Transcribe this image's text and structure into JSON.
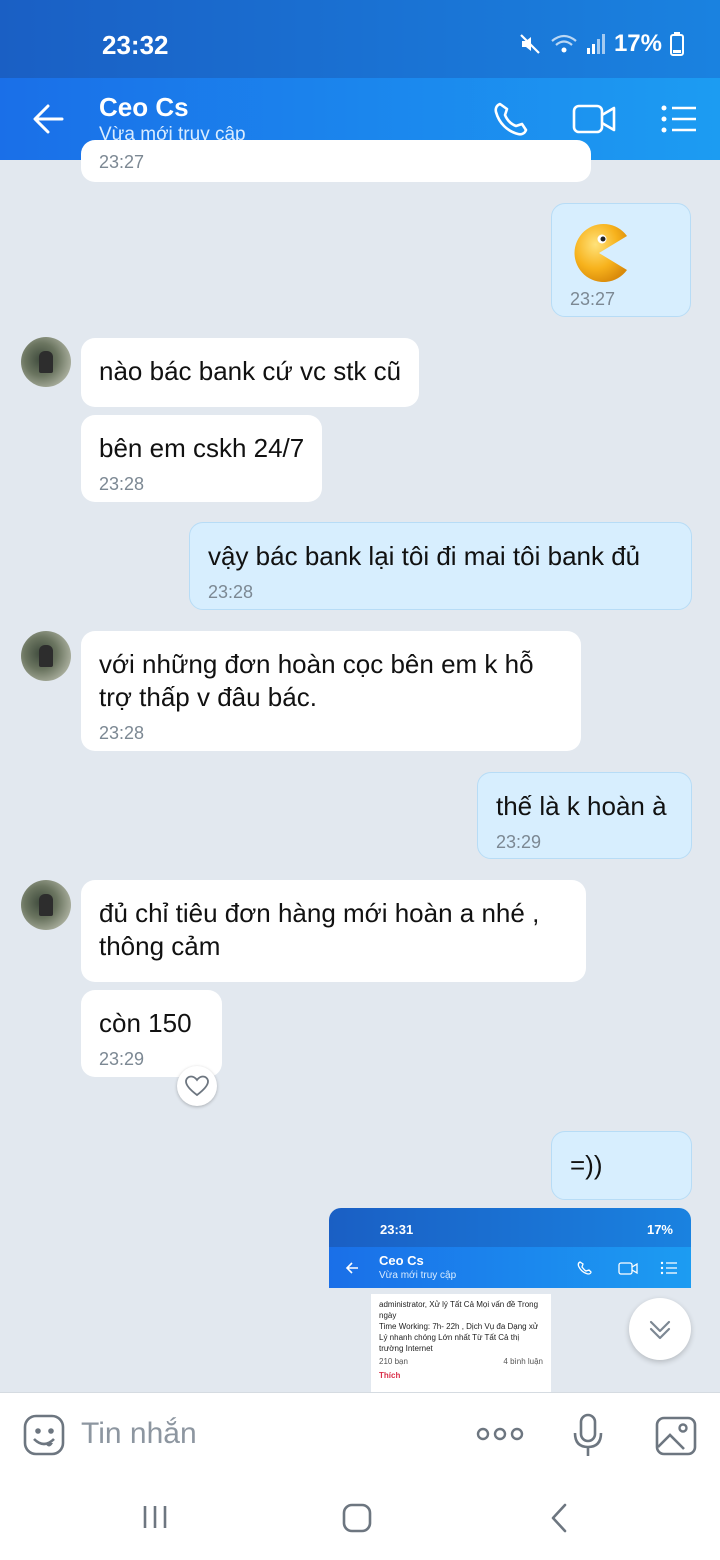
{
  "status_bar": {
    "time": "23:32",
    "battery": "17%"
  },
  "header": {
    "title": "Ceo Cs",
    "subtitle": "Vừa mới truy cập"
  },
  "messages": [
    {
      "dir": "in",
      "time": "23:27"
    },
    {
      "dir": "out",
      "kind": "sticker",
      "sticker": "pacman-sticker",
      "time": "23:27"
    },
    {
      "dir": "in",
      "text": "nào bác bank cứ vc stk cũ"
    },
    {
      "dir": "in",
      "text": "bên em cskh 24/7",
      "time": "23:28"
    },
    {
      "dir": "out",
      "text": "vậy bác bank lại tôi đi mai tôi bank đủ",
      "time": "23:28"
    },
    {
      "dir": "in",
      "text": "với những đơn hoàn cọc bên em k hỗ trợ thấp v đâu bác.",
      "time": "23:28"
    },
    {
      "dir": "out",
      "text": "thế là k hoàn à",
      "time": "23:29"
    },
    {
      "dir": "in",
      "text": "đủ chỉ tiêu đơn hàng mới hoàn a nhé , thông cảm"
    },
    {
      "dir": "in",
      "text": "còn 150",
      "time": "23:29"
    },
    {
      "dir": "out",
      "text": "=))"
    }
  ],
  "screenshot_preview": {
    "time": "23:31",
    "battery": "17%",
    "title": "Ceo Cs",
    "subtitle": "Vừa mới truy cập",
    "card_line1": "administrator, Xử lý Tất Cả Mọi vấn đề Trong ngày",
    "card_line2": "Time Working: 7h- 22h , Dịch Vụ đa Dạng xử Lý nhanh chóng Lớn nhất Từ Tất Cả thị trường Internet",
    "friends": "210 bạn",
    "comments": "4 bình luận",
    "like": "Thích"
  },
  "composer": {
    "placeholder": "Tin nhắn"
  },
  "colors": {
    "header": "#1a6fe8",
    "bubble_out": "#d7eefe",
    "bubble_in": "#ffffff",
    "background": "#e2e8ef"
  }
}
